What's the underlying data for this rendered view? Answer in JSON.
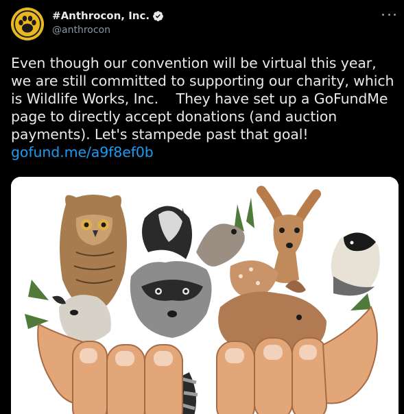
{
  "tweet": {
    "display_name": "#Anthrocon, Inc.",
    "handle": "@anthrocon",
    "text": "Even though our convention will be virtual this year, we are still committed to supporting our charity, which is Wildlife Works, Inc.    They have set up a GoFundMe page to directly accept donations (and auction payments). Let's stampede past that goal!",
    "link": "gofund.me/a9f8ef0b"
  },
  "icons": {
    "avatar": "paw-print-logo",
    "verified": "verified-badge-icon",
    "more": "more-options-icon"
  },
  "colors": {
    "background": "#000000",
    "text": "#e7e9ea",
    "secondary_text": "#8b98a5",
    "link": "#1d9bf0",
    "avatar_bg": "#e9b821"
  }
}
